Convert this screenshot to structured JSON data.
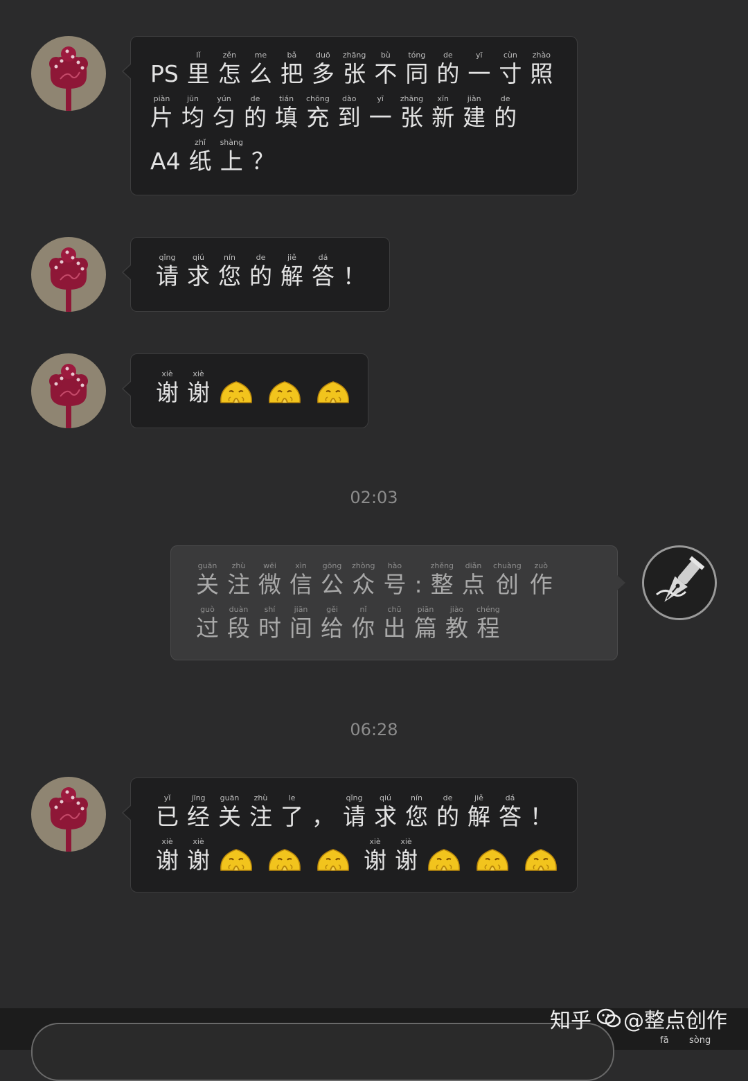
{
  "conversation": {
    "messages": [
      {
        "lines": [
          [
            [
              "PS",
              ""
            ],
            [
              "里",
              "lǐ"
            ],
            [
              "怎",
              "zěn"
            ],
            [
              "么",
              "me"
            ],
            [
              "把",
              "bǎ"
            ],
            [
              "多",
              "duō"
            ],
            [
              "张",
              "zhāng"
            ],
            [
              "不",
              "bù"
            ],
            [
              "同",
              "tóng"
            ],
            [
              "的",
              "de"
            ],
            [
              "一",
              "yī"
            ],
            [
              "寸",
              "cùn"
            ],
            [
              "照",
              "zhào"
            ]
          ],
          [
            [
              "片",
              "piàn"
            ],
            [
              "均",
              "jūn"
            ],
            [
              "匀",
              "yún"
            ],
            [
              "的",
              "de"
            ],
            [
              "填",
              "tián"
            ],
            [
              "充",
              "chōng"
            ],
            [
              "到",
              "dào"
            ],
            [
              "一",
              "yī"
            ],
            [
              "张",
              "zhāng"
            ],
            [
              "新",
              "xīn"
            ],
            [
              "建",
              "jiàn"
            ],
            [
              "的",
              "de"
            ]
          ],
          [
            [
              "A4",
              ""
            ],
            [
              "纸",
              "zhǐ"
            ],
            [
              "上",
              "shàng"
            ],
            [
              "？",
              ""
            ]
          ]
        ]
      },
      {
        "lines": [
          [
            [
              "请",
              "qǐng"
            ],
            [
              "求",
              "qiú"
            ],
            [
              "您",
              "nín"
            ],
            [
              "的",
              "de"
            ],
            [
              "解",
              "jiě"
            ],
            [
              "答",
              "dá"
            ],
            [
              "！",
              ""
            ]
          ]
        ]
      },
      {
        "lines": [
          [
            [
              "谢",
              "xiè"
            ],
            [
              "谢",
              "xiè"
            ]
          ]
        ],
        "emoji_count": 3
      }
    ],
    "timestamp_1": "02:03",
    "reply": {
      "lines": [
        [
          [
            "关",
            "guān"
          ],
          [
            "注",
            "zhù"
          ],
          [
            "微",
            "wēi"
          ],
          [
            "信",
            "xìn"
          ],
          [
            "公",
            "gōng"
          ],
          [
            "众",
            "zhòng"
          ],
          [
            "号",
            "hào"
          ],
          [
            ":",
            ""
          ],
          [
            "整",
            "zhěng"
          ],
          [
            "点",
            "diǎn"
          ],
          [
            "创",
            "chuàng"
          ],
          [
            "作",
            "zuò"
          ]
        ],
        [
          [
            "过",
            "guò"
          ],
          [
            "段",
            "duàn"
          ],
          [
            "时",
            "shí"
          ],
          [
            "间",
            "jiān"
          ],
          [
            "给",
            "gěi"
          ],
          [
            "你",
            "nǐ"
          ],
          [
            "出",
            "chū"
          ],
          [
            "篇",
            "piān"
          ],
          [
            "教",
            "jiào"
          ],
          [
            "程",
            "chéng"
          ]
        ]
      ]
    },
    "timestamp_2": "06:28",
    "final": {
      "line1": [
        [
          "已",
          "yǐ"
        ],
        [
          "经",
          "jīng"
        ],
        [
          "关",
          "guān"
        ],
        [
          "注",
          "zhù"
        ],
        [
          "了",
          "le"
        ],
        [
          "，",
          ""
        ],
        [
          "请",
          "qǐng"
        ],
        [
          "求",
          "qiú"
        ],
        [
          "您",
          "nín"
        ],
        [
          "的",
          "de"
        ],
        [
          "解",
          "jiě"
        ],
        [
          "答",
          "dá"
        ],
        [
          "！",
          ""
        ]
      ],
      "line2_text": [
        [
          "谢",
          "xiè"
        ],
        [
          "谢",
          "xiè"
        ]
      ],
      "emoji_count": 3
    }
  },
  "watermark": {
    "site": "知乎",
    "account": "@整点创作"
  },
  "bottom_pinyin": [
    "fā",
    "sòng"
  ],
  "colors": {
    "background": "#2b2b2c",
    "bubble": "#1e1e1f",
    "emoji": "#f2c41d",
    "avatar_flower": "#8e1737"
  }
}
